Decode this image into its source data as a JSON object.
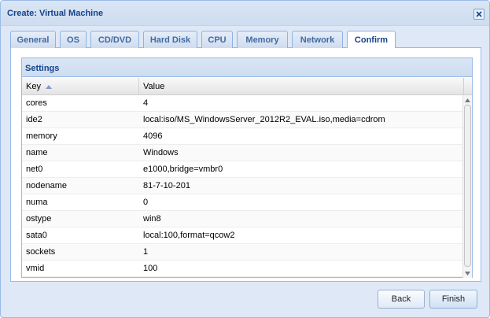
{
  "window": {
    "title": "Create: Virtual Machine"
  },
  "tabs": [
    {
      "label": "General"
    },
    {
      "label": "OS"
    },
    {
      "label": "CD/DVD"
    },
    {
      "label": "Hard Disk"
    },
    {
      "label": "CPU"
    },
    {
      "label": "Memory"
    },
    {
      "label": "Network"
    },
    {
      "label": "Confirm",
      "active": true
    }
  ],
  "settings": {
    "title": "Settings",
    "columns": {
      "key": "Key",
      "value": "Value"
    },
    "sort": {
      "column": "key",
      "direction": "asc"
    },
    "rows": [
      {
        "key": "cores",
        "value": "4"
      },
      {
        "key": "ide2",
        "value": "local:iso/MS_WindowsServer_2012R2_EVAL.iso,media=cdrom"
      },
      {
        "key": "memory",
        "value": "4096"
      },
      {
        "key": "name",
        "value": "Windows"
      },
      {
        "key": "net0",
        "value": "e1000,bridge=vmbr0"
      },
      {
        "key": "nodename",
        "value": "81-7-10-201"
      },
      {
        "key": "numa",
        "value": "0"
      },
      {
        "key": "ostype",
        "value": "win8"
      },
      {
        "key": "sata0",
        "value": "local:100,format=qcow2"
      },
      {
        "key": "sockets",
        "value": "1"
      },
      {
        "key": "vmid",
        "value": "100"
      }
    ]
  },
  "buttons": {
    "back": "Back",
    "finish": "Finish"
  },
  "colors": {
    "accent": "#15428b",
    "border": "#99bbe8",
    "background": "#dfe8f6"
  }
}
